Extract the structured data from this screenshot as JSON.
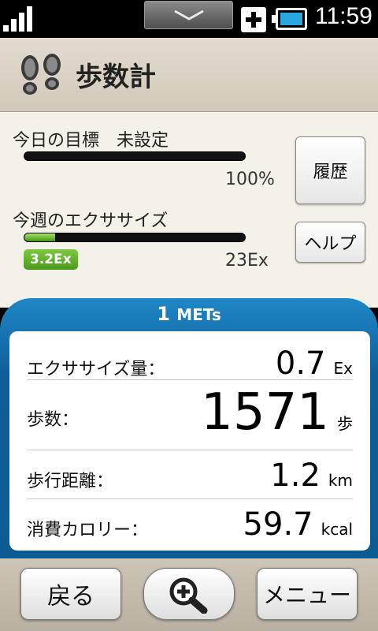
{
  "status_bar": {
    "time": "11:59",
    "icons": [
      "signal-icon",
      "notification-handle-icon",
      "plus-icon",
      "battery-icon"
    ]
  },
  "header": {
    "title": "歩数計",
    "icon": "footsteps-icon"
  },
  "goal": {
    "label": "今日の目標　未設定",
    "percent_text": "100%",
    "progress": 0
  },
  "exercise": {
    "label": "今週のエクササイズ",
    "current_badge": "3.2Ex",
    "target_text": "23Ex",
    "progress": 0.139
  },
  "side_buttons": {
    "history": "履歴",
    "help": "ヘルプ"
  },
  "mets": {
    "value": "1",
    "unit": "METs"
  },
  "stats": [
    {
      "label": "エクササイズ量：",
      "value": "0.7",
      "unit": "Ex"
    },
    {
      "label": "歩数：",
      "value": "1571",
      "unit": "歩"
    },
    {
      "label": "歩行距離：",
      "value": "1.2",
      "unit": "km"
    },
    {
      "label": "消費カロリー：",
      "value": "59.7",
      "unit": "kcal"
    }
  ],
  "bottom_buttons": {
    "back": "戻る",
    "zoom_icon": "zoom-in-icon",
    "menu": "メニュー"
  },
  "colors": {
    "accent_blue": "#1f87c6",
    "progress_green": "#4a9a1c",
    "header_bg": "#d8d1c2"
  }
}
